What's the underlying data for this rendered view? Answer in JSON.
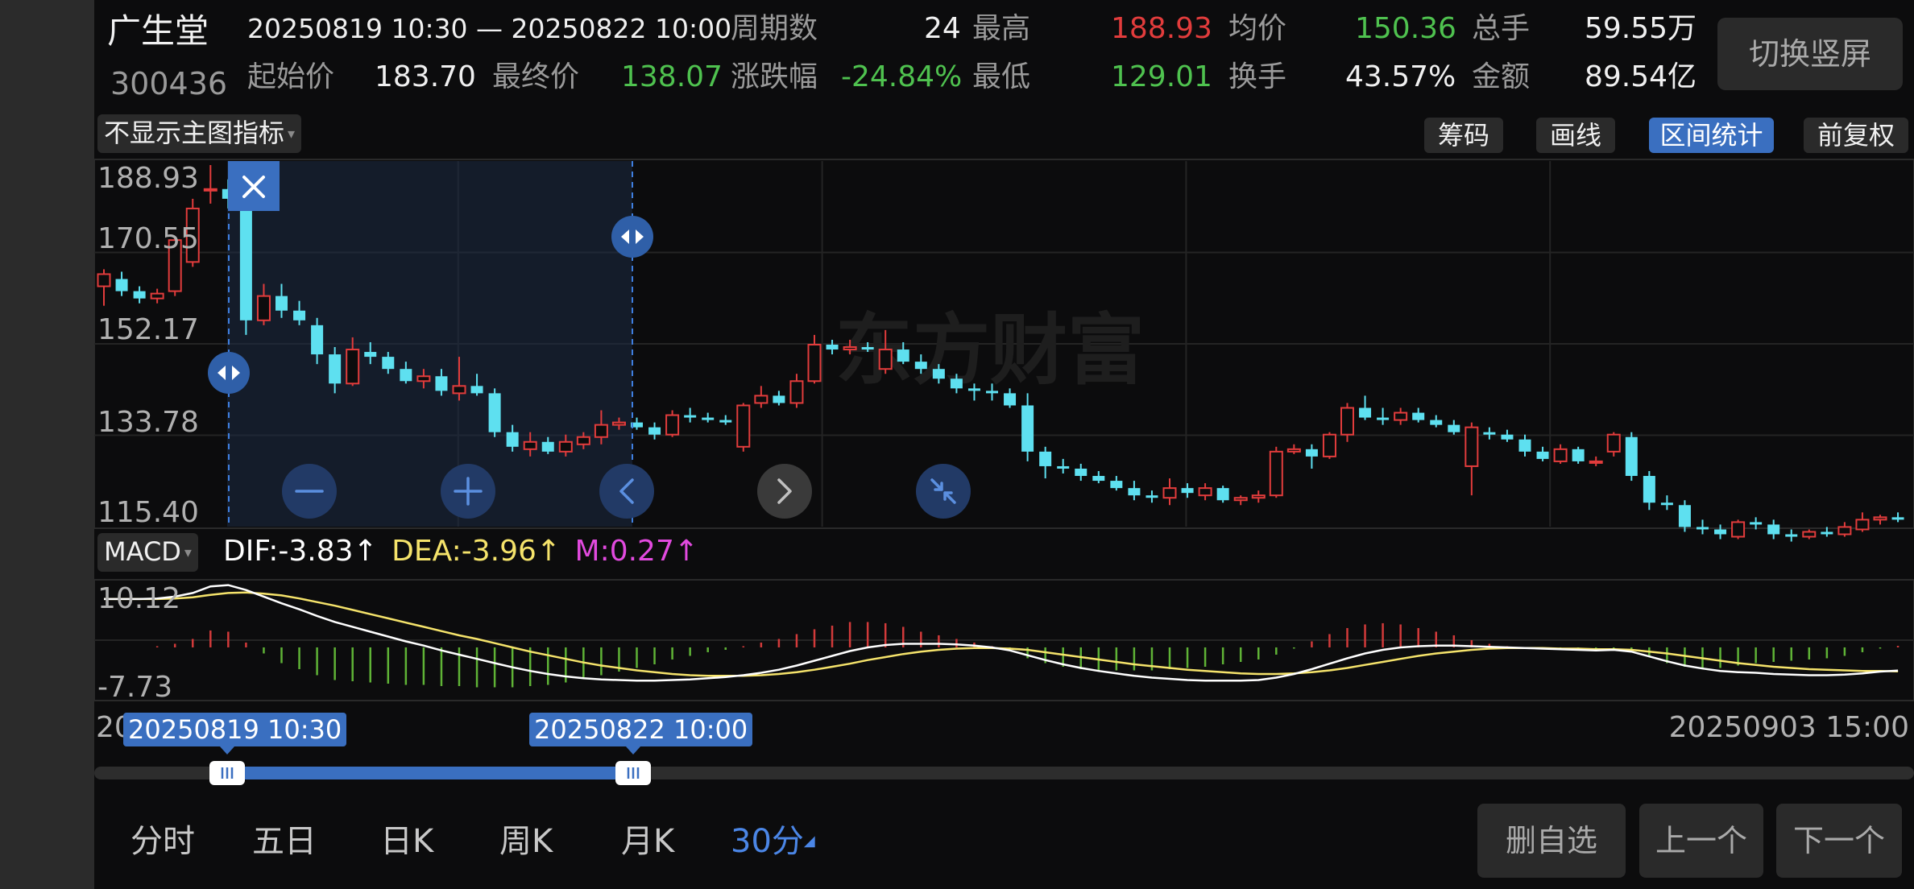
{
  "header": {
    "stock_name": "广生堂",
    "stock_code": "300436",
    "range": "20250819 10:30 — 20250822 10:00",
    "stats": [
      {
        "label": "周期数",
        "value": "24",
        "tone": "val"
      },
      {
        "label": "最高",
        "value": "188.93",
        "tone": "red"
      },
      {
        "label": "均价",
        "value": "150.36",
        "tone": "green"
      },
      {
        "label": "总手",
        "value": "59.55万",
        "tone": "val"
      },
      {
        "label": "起始价",
        "value": "183.70",
        "tone": "val"
      },
      {
        "label": "最终价",
        "value": "138.07",
        "tone": "green"
      },
      {
        "label": "涨跌幅",
        "value": "-24.84%",
        "tone": "green"
      },
      {
        "label": "最低",
        "value": "129.01",
        "tone": "green"
      },
      {
        "label": "换手",
        "value": "43.57%",
        "tone": "val"
      },
      {
        "label": "金额",
        "value": "89.54亿",
        "tone": "val"
      }
    ],
    "portrait_button": "切换竖屏"
  },
  "toolbar": {
    "main_indicator": "不显示主图指标",
    "tools": [
      "筹码",
      "画线",
      "区间统计",
      "前复权"
    ],
    "active_tool": "区间统计"
  },
  "main_chart": {
    "y_labels": [
      "188.93",
      "170.55",
      "152.17",
      "133.78",
      "115.40"
    ],
    "watermark": "东方财富",
    "controls": [
      "zoom-out",
      "zoom-in",
      "scroll-left",
      "scroll-right",
      "collapse"
    ]
  },
  "macd": {
    "selector": "MACD",
    "dif_text": "DIF:-3.83↑",
    "dea_text": "DEA:-3.96↑",
    "m_text": "M:0.27↑",
    "y_labels": [
      "10.12",
      "-7.73"
    ]
  },
  "range_selector": {
    "start_tag": "20250819 10:30",
    "end_tag": "20250822 10:00",
    "left_date_fragment": "20",
    "right_date": "20250903 15:00"
  },
  "period_tabs": [
    "分时",
    "五日",
    "日K",
    "周K",
    "月K",
    "30分"
  ],
  "active_period": "30分",
  "actions": [
    "删自选",
    "上一个",
    "下一个"
  ],
  "colors": {
    "up": "#e23c3c",
    "down": "#5ee0f0",
    "accent": "#3a6fc0",
    "dif": "#ffffff",
    "dea": "#f5e36b",
    "m": "#e24adf",
    "hist_pos": "#d23a3a",
    "hist_neg": "#5fb336"
  },
  "chart_data": {
    "type": "candlestick",
    "price_range": [
      115.4,
      188.93
    ],
    "candles": [
      {
        "o": 164.0,
        "h": 167.5,
        "l": 160.0,
        "c": 166.5
      },
      {
        "o": 165.5,
        "h": 167.0,
        "l": 162.0,
        "c": 163.0
      },
      {
        "o": 163.0,
        "h": 164.0,
        "l": 160.5,
        "c": 161.5
      },
      {
        "o": 161.5,
        "h": 163.5,
        "l": 160.5,
        "c": 162.5
      },
      {
        "o": 163.0,
        "h": 174.0,
        "l": 162.0,
        "c": 173.5
      },
      {
        "o": 169.0,
        "h": 182.0,
        "l": 168.0,
        "c": 180.0
      },
      {
        "o": 183.7,
        "h": 188.93,
        "l": 181.0,
        "c": 184.0
      },
      {
        "o": 184.0,
        "h": 186.0,
        "l": 180.0,
        "c": 182.0
      },
      {
        "o": 182.0,
        "h": 183.5,
        "l": 154.0,
        "c": 157.0
      },
      {
        "o": 157.0,
        "h": 164.5,
        "l": 156.0,
        "c": 162.0
      },
      {
        "o": 162.0,
        "h": 164.5,
        "l": 157.5,
        "c": 159.0
      },
      {
        "o": 159.0,
        "h": 161.0,
        "l": 156.0,
        "c": 157.0
      },
      {
        "o": 156.0,
        "h": 157.5,
        "l": 148.0,
        "c": 150.0
      },
      {
        "o": 150.0,
        "h": 151.5,
        "l": 142.0,
        "c": 144.0
      },
      {
        "o": 144.0,
        "h": 153.5,
        "l": 143.5,
        "c": 151.0
      },
      {
        "o": 150.5,
        "h": 152.5,
        "l": 148.0,
        "c": 149.5
      },
      {
        "o": 149.5,
        "h": 150.5,
        "l": 146.0,
        "c": 147.0
      },
      {
        "o": 147.0,
        "h": 148.5,
        "l": 144.0,
        "c": 144.5
      },
      {
        "o": 144.5,
        "h": 147.0,
        "l": 143.0,
        "c": 145.5
      },
      {
        "o": 145.5,
        "h": 147.0,
        "l": 141.5,
        "c": 142.5
      },
      {
        "o": 142.0,
        "h": 149.5,
        "l": 140.5,
        "c": 143.5
      },
      {
        "o": 143.5,
        "h": 146.0,
        "l": 141.5,
        "c": 142.0
      },
      {
        "o": 142.0,
        "h": 143.0,
        "l": 133.0,
        "c": 134.0
      },
      {
        "o": 134.0,
        "h": 135.5,
        "l": 130.0,
        "c": 131.0
      },
      {
        "o": 130.5,
        "h": 134.0,
        "l": 129.01,
        "c": 132.0
      },
      {
        "o": 132.0,
        "h": 133.0,
        "l": 129.5,
        "c": 130.0
      },
      {
        "o": 130.0,
        "h": 133.5,
        "l": 129.0,
        "c": 132.0
      },
      {
        "o": 131.5,
        "h": 134.0,
        "l": 130.5,
        "c": 133.0
      },
      {
        "o": 133.0,
        "h": 138.5,
        "l": 131.5,
        "c": 135.5
      },
      {
        "o": 135.5,
        "h": 137.0,
        "l": 134.5,
        "c": 136.0
      },
      {
        "o": 136.0,
        "h": 137.0,
        "l": 134.5,
        "c": 135.0
      },
      {
        "o": 135.0,
        "h": 136.0,
        "l": 132.5,
        "c": 133.5
      },
      {
        "o": 133.5,
        "h": 138.5,
        "l": 133.0,
        "c": 137.5
      },
      {
        "o": 137.5,
        "h": 139.0,
        "l": 136.0,
        "c": 137.0
      },
      {
        "o": 137.0,
        "h": 138.0,
        "l": 136.0,
        "c": 136.5
      },
      {
        "o": 136.5,
        "h": 137.5,
        "l": 135.5,
        "c": 136.0
      },
      {
        "o": 131.0,
        "h": 140.0,
        "l": 130.0,
        "c": 139.5
      },
      {
        "o": 140.0,
        "h": 143.5,
        "l": 139.0,
        "c": 141.5
      },
      {
        "o": 141.5,
        "h": 142.5,
        "l": 139.5,
        "c": 140.0
      },
      {
        "o": 140.0,
        "h": 146.0,
        "l": 139.0,
        "c": 144.5
      },
      {
        "o": 144.5,
        "h": 154.0,
        "l": 144.0,
        "c": 152.0
      },
      {
        "o": 152.0,
        "h": 153.0,
        "l": 150.0,
        "c": 151.0
      },
      {
        "o": 151.0,
        "h": 153.0,
        "l": 150.0,
        "c": 151.5
      },
      {
        "o": 151.5,
        "h": 152.5,
        "l": 150.5,
        "c": 151.0
      },
      {
        "o": 147.0,
        "h": 155.0,
        "l": 146.0,
        "c": 151.0
      },
      {
        "o": 151.0,
        "h": 152.5,
        "l": 148.0,
        "c": 148.5
      },
      {
        "o": 148.5,
        "h": 150.0,
        "l": 146.0,
        "c": 147.0
      },
      {
        "o": 147.0,
        "h": 148.0,
        "l": 144.0,
        "c": 145.0
      },
      {
        "o": 145.0,
        "h": 146.0,
        "l": 142.0,
        "c": 143.0
      },
      {
        "o": 143.0,
        "h": 144.0,
        "l": 140.5,
        "c": 142.5
      },
      {
        "o": 142.5,
        "h": 144.0,
        "l": 140.5,
        "c": 142.0
      },
      {
        "o": 142.0,
        "h": 143.0,
        "l": 139.0,
        "c": 139.5
      },
      {
        "o": 139.5,
        "h": 142.0,
        "l": 128.0,
        "c": 130.0
      },
      {
        "o": 130.0,
        "h": 131.0,
        "l": 124.5,
        "c": 127.0
      },
      {
        "o": 127.0,
        "h": 128.5,
        "l": 125.5,
        "c": 126.5
      },
      {
        "o": 126.5,
        "h": 127.5,
        "l": 124.0,
        "c": 125.0
      },
      {
        "o": 125.0,
        "h": 126.0,
        "l": 123.5,
        "c": 124.0
      },
      {
        "o": 124.0,
        "h": 125.0,
        "l": 122.0,
        "c": 122.5
      },
      {
        "o": 122.5,
        "h": 124.0,
        "l": 120.0,
        "c": 121.0
      },
      {
        "o": 121.0,
        "h": 122.0,
        "l": 119.5,
        "c": 120.5
      },
      {
        "o": 120.5,
        "h": 124.5,
        "l": 119.0,
        "c": 122.5
      },
      {
        "o": 122.5,
        "h": 123.5,
        "l": 120.5,
        "c": 121.5
      },
      {
        "o": 121.0,
        "h": 123.5,
        "l": 120.0,
        "c": 122.5
      },
      {
        "o": 122.5,
        "h": 123.0,
        "l": 119.5,
        "c": 120.0
      },
      {
        "o": 120.0,
        "h": 121.0,
        "l": 119.0,
        "c": 120.5
      },
      {
        "o": 120.5,
        "h": 122.0,
        "l": 119.5,
        "c": 121.0
      },
      {
        "o": 121.0,
        "h": 131.0,
        "l": 120.5,
        "c": 130.0
      },
      {
        "o": 130.0,
        "h": 131.5,
        "l": 129.5,
        "c": 130.5
      },
      {
        "o": 130.5,
        "h": 131.5,
        "l": 126.5,
        "c": 129.0
      },
      {
        "o": 129.0,
        "h": 134.0,
        "l": 128.5,
        "c": 133.5
      },
      {
        "o": 133.5,
        "h": 140.0,
        "l": 132.0,
        "c": 139.0
      },
      {
        "o": 139.0,
        "h": 141.5,
        "l": 136.5,
        "c": 137.0
      },
      {
        "o": 137.0,
        "h": 139.0,
        "l": 135.5,
        "c": 136.5
      },
      {
        "o": 136.5,
        "h": 139.0,
        "l": 135.5,
        "c": 138.0
      },
      {
        "o": 138.0,
        "h": 139.0,
        "l": 136.0,
        "c": 136.5
      },
      {
        "o": 136.5,
        "h": 137.5,
        "l": 135.0,
        "c": 135.5
      },
      {
        "o": 135.5,
        "h": 136.5,
        "l": 133.5,
        "c": 134.0
      },
      {
        "o": 127.0,
        "h": 136.0,
        "l": 121.0,
        "c": 135.0
      },
      {
        "o": 134.0,
        "h": 135.0,
        "l": 132.5,
        "c": 133.5
      },
      {
        "o": 133.5,
        "h": 134.5,
        "l": 132.0,
        "c": 132.5
      },
      {
        "o": 132.5,
        "h": 133.5,
        "l": 129.0,
        "c": 130.0
      },
      {
        "o": 130.0,
        "h": 131.0,
        "l": 128.0,
        "c": 128.5
      },
      {
        "o": 128.0,
        "h": 131.5,
        "l": 127.5,
        "c": 130.5
      },
      {
        "o": 130.5,
        "h": 131.0,
        "l": 127.5,
        "c": 128.0
      },
      {
        "o": 128.0,
        "h": 129.0,
        "l": 127.0,
        "c": 128.0
      },
      {
        "o": 130.0,
        "h": 134.0,
        "l": 129.0,
        "c": 133.5
      },
      {
        "o": 133.0,
        "h": 134.0,
        "l": 124.0,
        "c": 125.0
      },
      {
        "o": 125.0,
        "h": 126.0,
        "l": 118.0,
        "c": 119.5
      },
      {
        "o": 119.5,
        "h": 121.0,
        "l": 118.0,
        "c": 119.0
      },
      {
        "o": 119.0,
        "h": 120.0,
        "l": 113.5,
        "c": 114.5
      },
      {
        "o": 114.5,
        "h": 116.0,
        "l": 113.0,
        "c": 114.0
      },
      {
        "o": 114.0,
        "h": 115.0,
        "l": 112.0,
        "c": 113.0
      },
      {
        "o": 112.5,
        "h": 116.0,
        "l": 112.0,
        "c": 115.5
      },
      {
        "o": 115.5,
        "h": 116.5,
        "l": 114.0,
        "c": 115.0
      },
      {
        "o": 115.0,
        "h": 116.0,
        "l": 112.0,
        "c": 113.0
      },
      {
        "o": 113.0,
        "h": 114.0,
        "l": 111.5,
        "c": 112.5
      },
      {
        "o": 112.5,
        "h": 114.0,
        "l": 112.0,
        "c": 113.5
      },
      {
        "o": 113.5,
        "h": 114.5,
        "l": 112.5,
        "c": 113.0
      },
      {
        "o": 113.0,
        "h": 115.5,
        "l": 112.5,
        "c": 114.5
      },
      {
        "o": 114.0,
        "h": 117.5,
        "l": 113.5,
        "c": 116.0
      },
      {
        "o": 116.0,
        "h": 117.0,
        "l": 115.0,
        "c": 116.5
      },
      {
        "o": 116.5,
        "h": 117.5,
        "l": 115.5,
        "c": 116.0
      }
    ],
    "macd_range": [
      -7.73,
      10.12
    ],
    "macd": {
      "dif": [
        8.0,
        8.0,
        8.0,
        8.1,
        8.4,
        9.0,
        10.1,
        10.3,
        9.5,
        8.4,
        7.3,
        6.3,
        5.2,
        4.2,
        3.4,
        2.6,
        1.8,
        1.0,
        0.3,
        -0.5,
        -1.2,
        -1.9,
        -2.6,
        -3.3,
        -3.9,
        -4.4,
        -4.8,
        -5.1,
        -5.3,
        -5.4,
        -5.5,
        -5.5,
        -5.4,
        -5.3,
        -5.1,
        -4.9,
        -4.6,
        -4.2,
        -3.7,
        -3.0,
        -2.2,
        -1.4,
        -0.6,
        0.0,
        0.4,
        0.6,
        0.6,
        0.6,
        0.5,
        0.3,
        0.0,
        -0.5,
        -1.3,
        -2.1,
        -2.8,
        -3.4,
        -3.9,
        -4.3,
        -4.7,
        -5.0,
        -5.2,
        -5.4,
        -5.5,
        -5.5,
        -5.5,
        -5.4,
        -5.0,
        -4.4,
        -3.6,
        -2.7,
        -1.8,
        -1.0,
        -0.4,
        0.0,
        0.2,
        0.3,
        0.3,
        0.2,
        0.1,
        0.0,
        -0.1,
        -0.2,
        -0.3,
        -0.4,
        -0.5,
        -0.4,
        -0.7,
        -1.5,
        -2.3,
        -3.0,
        -3.5,
        -3.9,
        -4.1,
        -4.2,
        -4.4,
        -4.5,
        -4.6,
        -4.6,
        -4.5,
        -4.3,
        -4.0,
        -3.83
      ],
      "dea": [
        8.0,
        8.0,
        8.0,
        8.0,
        8.1,
        8.3,
        8.7,
        9.0,
        9.1,
        8.9,
        8.6,
        8.1,
        7.5,
        6.9,
        6.2,
        5.5,
        4.8,
        4.1,
        3.4,
        2.7,
        2.0,
        1.4,
        0.7,
        0.0,
        -0.7,
        -1.3,
        -1.9,
        -2.5,
        -3.0,
        -3.4,
        -3.8,
        -4.1,
        -4.4,
        -4.6,
        -4.7,
        -4.7,
        -4.7,
        -4.6,
        -4.4,
        -4.1,
        -3.7,
        -3.2,
        -2.7,
        -2.1,
        -1.6,
        -1.1,
        -0.7,
        -0.4,
        -0.2,
        -0.1,
        -0.1,
        -0.2,
        -0.4,
        -0.8,
        -1.2,
        -1.6,
        -2.0,
        -2.4,
        -2.8,
        -3.1,
        -3.4,
        -3.7,
        -3.9,
        -4.1,
        -4.3,
        -4.4,
        -4.4,
        -4.3,
        -4.1,
        -3.8,
        -3.4,
        -2.9,
        -2.4,
        -1.9,
        -1.4,
        -1.0,
        -0.7,
        -0.4,
        -0.2,
        -0.1,
        -0.1,
        -0.1,
        -0.2,
        -0.2,
        -0.3,
        -0.3,
        -0.4,
        -0.7,
        -1.0,
        -1.4,
        -1.8,
        -2.2,
        -2.6,
        -2.9,
        -3.2,
        -3.4,
        -3.6,
        -3.7,
        -3.8,
        -3.9,
        -3.9,
        -3.96
      ]
    }
  }
}
